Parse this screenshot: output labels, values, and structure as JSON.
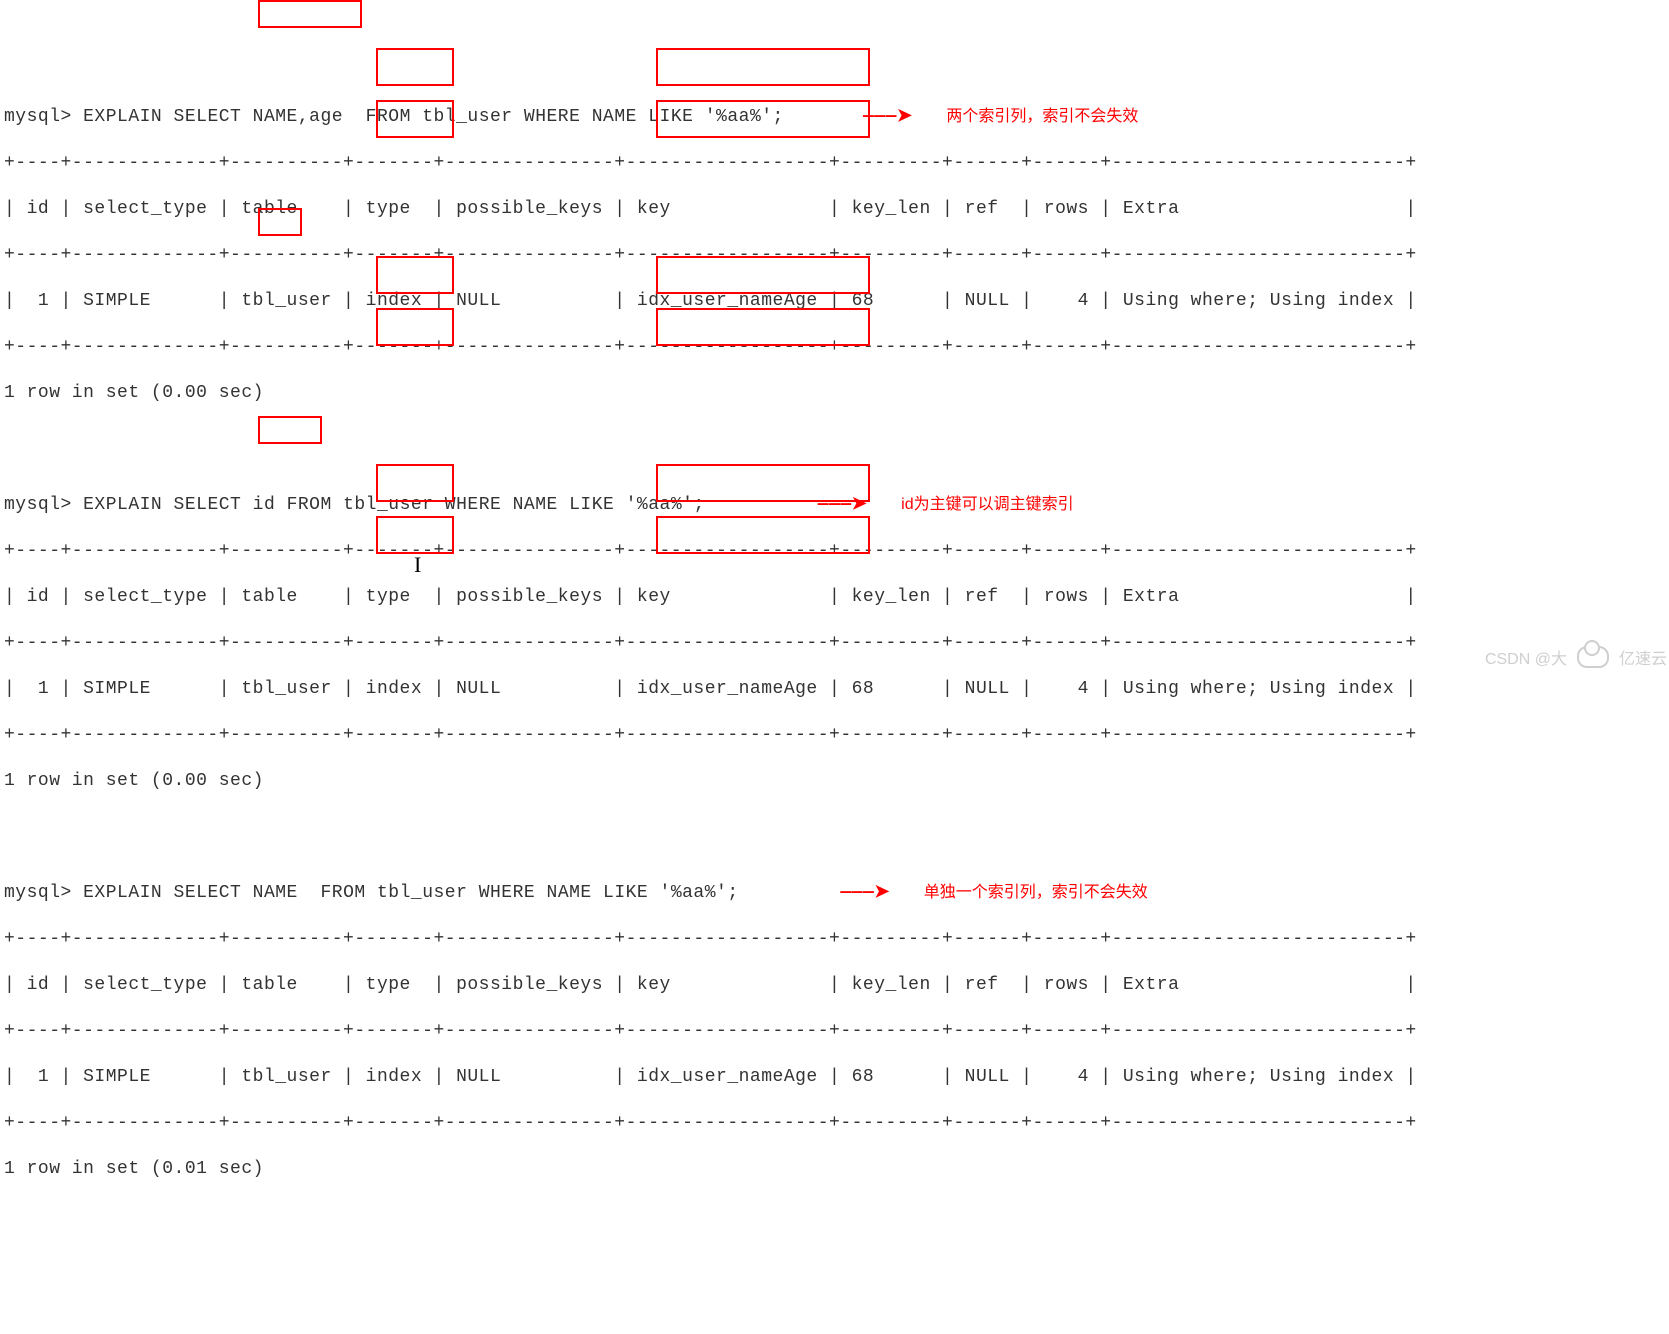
{
  "queries": [
    {
      "prompt": "mysql>",
      "sql_prefix": "EXPLAIN SELECT ",
      "highlighted_cols": "NAME,age",
      "sql_suffix": "  FROM tbl_user WHERE NAME LIKE '%aa%';",
      "arrow": "———➤",
      "annotation": "两个索引列，索引不会失效",
      "timing": "1 row in set (0.00 sec)"
    },
    {
      "prompt": "mysql>",
      "sql_prefix": "EXPLAIN SELECT ",
      "highlighted_cols": "id",
      "sql_suffix": " FROM tbl_user WHERE NAME LIKE '%aa%';",
      "arrow": "———➤",
      "annotation": "id为主键可以调主键索引",
      "timing": "1 row in set (0.00 sec)"
    },
    {
      "prompt": "mysql>",
      "sql_prefix": "EXPLAIN SELECT ",
      "highlighted_cols": "NAME",
      "sql_suffix": "  FROM tbl_user WHERE NAME LIKE '%aa%';",
      "arrow": "———➤",
      "annotation": "单独一个索引列，索引不会失效",
      "timing": "1 row in set (0.01 sec)"
    }
  ],
  "table": {
    "border": "+----+-------------+----------+-------+---------------+------------------+---------+------+------+--------------------------+",
    "header": "| id | select_type | table    | type  | possible_keys | key              | key_len | ref  | rows | Extra                    |",
    "row": "|  1 | SIMPLE      | tbl_user | index | NULL          | idx_user_nameAge | 68      | NULL |    4 | Using where; Using index |",
    "columns": [
      "id",
      "select_type",
      "table",
      "type",
      "possible_keys",
      "key",
      "key_len",
      "ref",
      "rows",
      "Extra"
    ],
    "values": [
      "1",
      "SIMPLE",
      "tbl_user",
      "index",
      "NULL",
      "idx_user_nameAge",
      "68",
      "NULL",
      "4",
      "Using where; Using index"
    ]
  },
  "watermark": {
    "csdn": "CSDN @大",
    "yisu": "亿速云"
  },
  "colors": {
    "highlight": "#ff0000",
    "text": "#333333"
  }
}
